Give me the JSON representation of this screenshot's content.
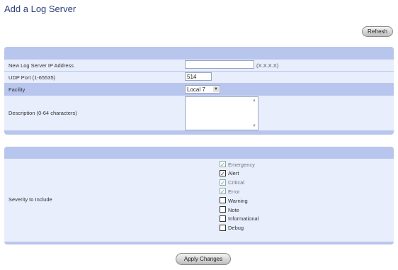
{
  "page": {
    "title": "Add a Log Server"
  },
  "toolbar": {
    "refresh_label": "Refresh"
  },
  "form": {
    "ip_label": "New Log Server IP Address",
    "ip_value": "",
    "ip_hint": "(X.X.X.X)",
    "udp_label": "UDP Port (1-65535)",
    "udp_value": "514",
    "facility_label": "Facility",
    "facility_value": "Local 7",
    "desc_label": "Description (0-64 characters)",
    "desc_value": ""
  },
  "severity": {
    "label": "Severity to Include",
    "items": [
      {
        "label": "Emergency",
        "checked": true,
        "disabled": true
      },
      {
        "label": "Alert",
        "checked": true,
        "disabled": false
      },
      {
        "label": "Critical",
        "checked": true,
        "disabled": true
      },
      {
        "label": "Error",
        "checked": true,
        "disabled": true
      },
      {
        "label": "Warning",
        "checked": false,
        "disabled": false
      },
      {
        "label": "Note",
        "checked": false,
        "disabled": false
      },
      {
        "label": "Informational",
        "checked": false,
        "disabled": false
      },
      {
        "label": "Debug",
        "checked": false,
        "disabled": false
      }
    ]
  },
  "footer": {
    "apply_label": "Apply Changes"
  },
  "colors": {
    "panel": "#b8c6ee",
    "row": "#e8eefc",
    "title": "#2a3f7a"
  }
}
